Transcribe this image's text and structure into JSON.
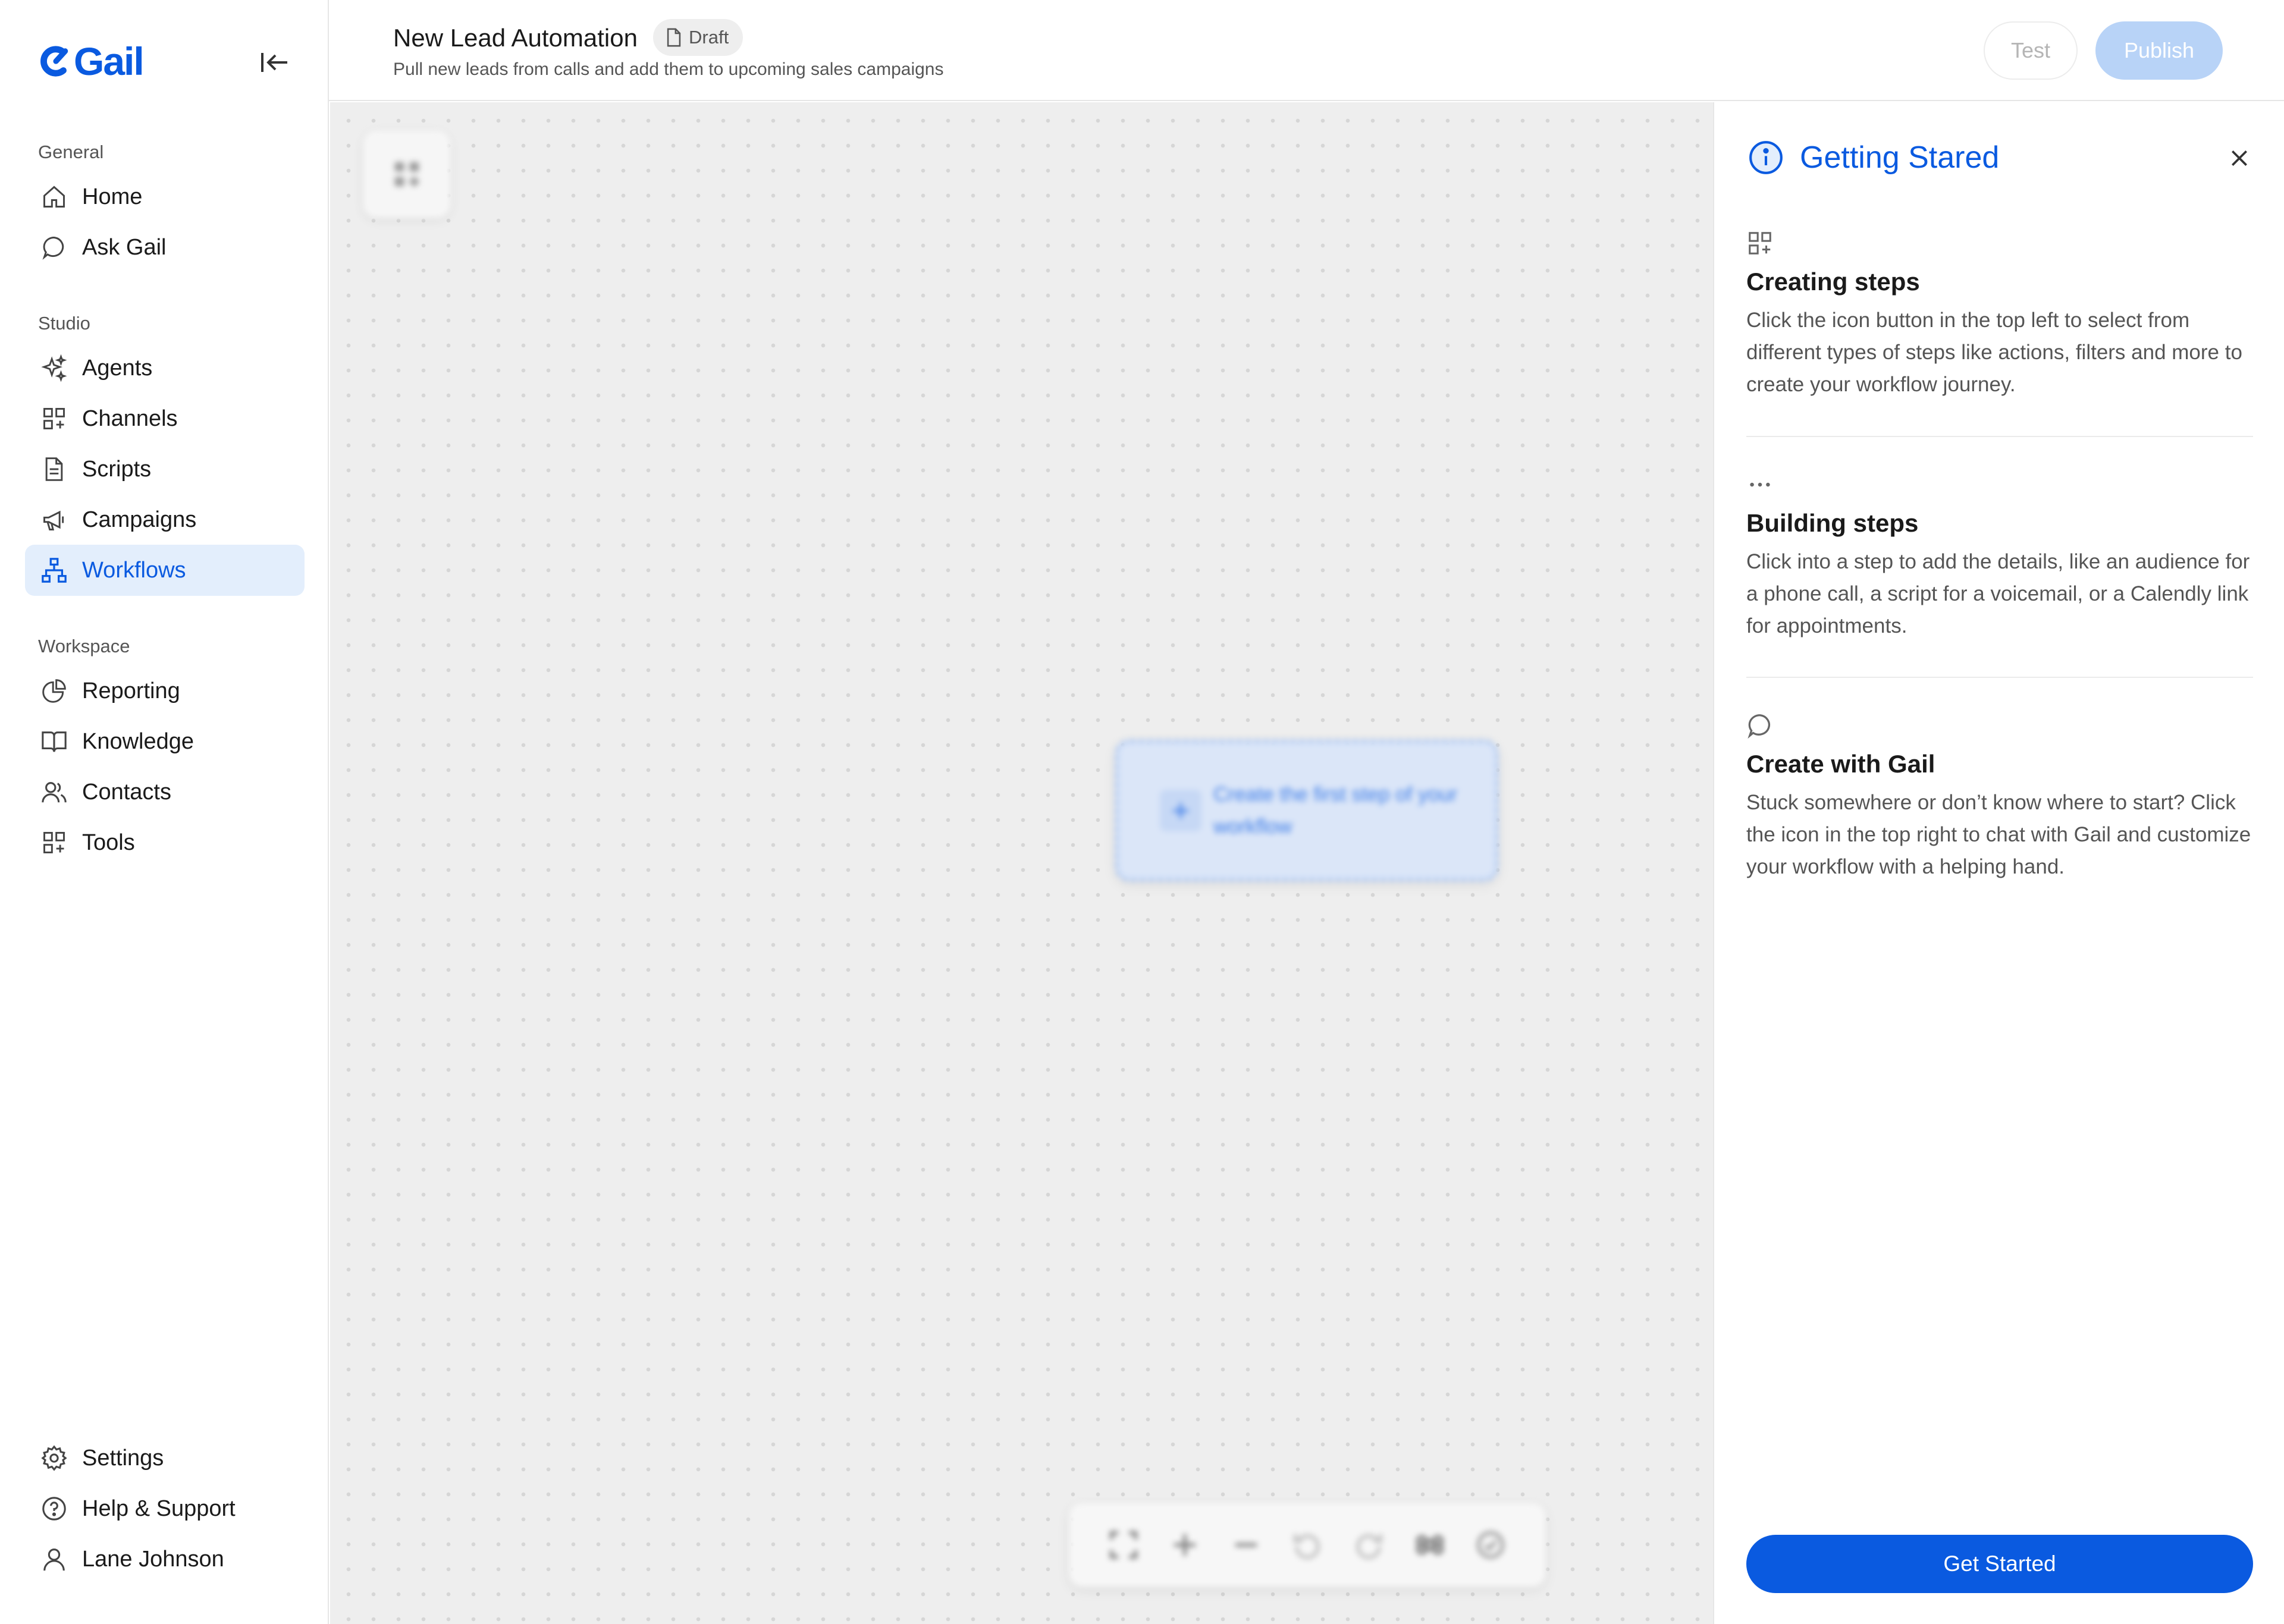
{
  "brand": {
    "name": "Gail",
    "color": "#0a5ae0"
  },
  "sidebar": {
    "sections": {
      "general": "General",
      "studio": "Studio",
      "workspace": "Workspace"
    },
    "items": {
      "home": "Home",
      "ask_gail": "Ask Gail",
      "agents": "Agents",
      "channels": "Channels",
      "scripts": "Scripts",
      "campaigns": "Campaigns",
      "workflows": "Workflows",
      "reporting": "Reporting",
      "knowledge": "Knowledge",
      "contacts": "Contacts",
      "tools": "Tools",
      "settings": "Settings",
      "help": "Help & Support",
      "user": "Lane Johnson"
    },
    "active_item": "Workflows"
  },
  "header": {
    "title": "New Lead Automation",
    "badge": "Draft",
    "subtitle": "Pull new leads from calls and add them to upcoming sales campaigns",
    "test_label": "Test",
    "publish_label": "Publish"
  },
  "canvas": {
    "first_step_text": "Create the first step of your workflow",
    "zoom_tools": [
      "fit-view-icon",
      "zoom-in-icon",
      "zoom-out-icon",
      "undo-icon",
      "redo-icon",
      "command-icon",
      "check-circle-icon"
    ]
  },
  "panel": {
    "title": "Getting Stared",
    "tips": [
      {
        "heading": "Creating steps",
        "body": "Click the icon button in the top left to select from different types of steps like actions, filters and more to create your workflow journey."
      },
      {
        "heading": "Building steps",
        "body": "Click into a step to add the details, like an audience for a phone call, a script for a voicemail, or a Calendly link for appointments."
      },
      {
        "heading": "Create with Gail",
        "body": "Stuck somewhere or don’t know where to start? Click the icon in the top right to chat with Gail and customize your workflow with a helping hand."
      }
    ],
    "cta": "Get Started"
  }
}
